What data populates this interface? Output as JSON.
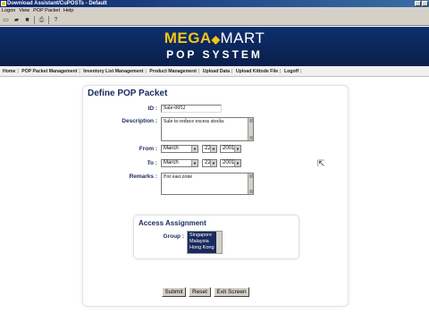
{
  "window": {
    "title": "Download Assistant/CuPOSTs - Default"
  },
  "menu": {
    "items": [
      "Logon",
      "View",
      "POP Packet",
      "Help"
    ]
  },
  "banner": {
    "brand_a": "MEGA",
    "brand_dot": "◆",
    "brand_b": "MART",
    "subtitle": "POP SYSTEM"
  },
  "nav": {
    "items": [
      "Home",
      "POP Packet Management",
      "Inventory List Management",
      "Product Management",
      "Upload Data",
      "Upload Kittode File",
      "Logoff"
    ]
  },
  "form": {
    "title": "Define POP Packet",
    "id_label": "ID :",
    "id_value": "Sale-0052",
    "description_label": "Description :",
    "description_value": "Sale to reduce excess stocks",
    "from_label": "From :",
    "from_month": "March",
    "from_day": "22",
    "from_year": "2001",
    "to_label": "To :",
    "to_month": "March",
    "to_day": "22",
    "to_year": "2001",
    "remarks_label": "Remarks :",
    "remarks_value": "For east zone"
  },
  "access": {
    "title": "Access Assignment",
    "group_label": "Group :",
    "groups": [
      "Singapore",
      "Malaysia",
      "Hong Kong"
    ]
  },
  "buttons": {
    "submit": "Submit",
    "reset": "Reset",
    "exit": "Exit Screen"
  }
}
